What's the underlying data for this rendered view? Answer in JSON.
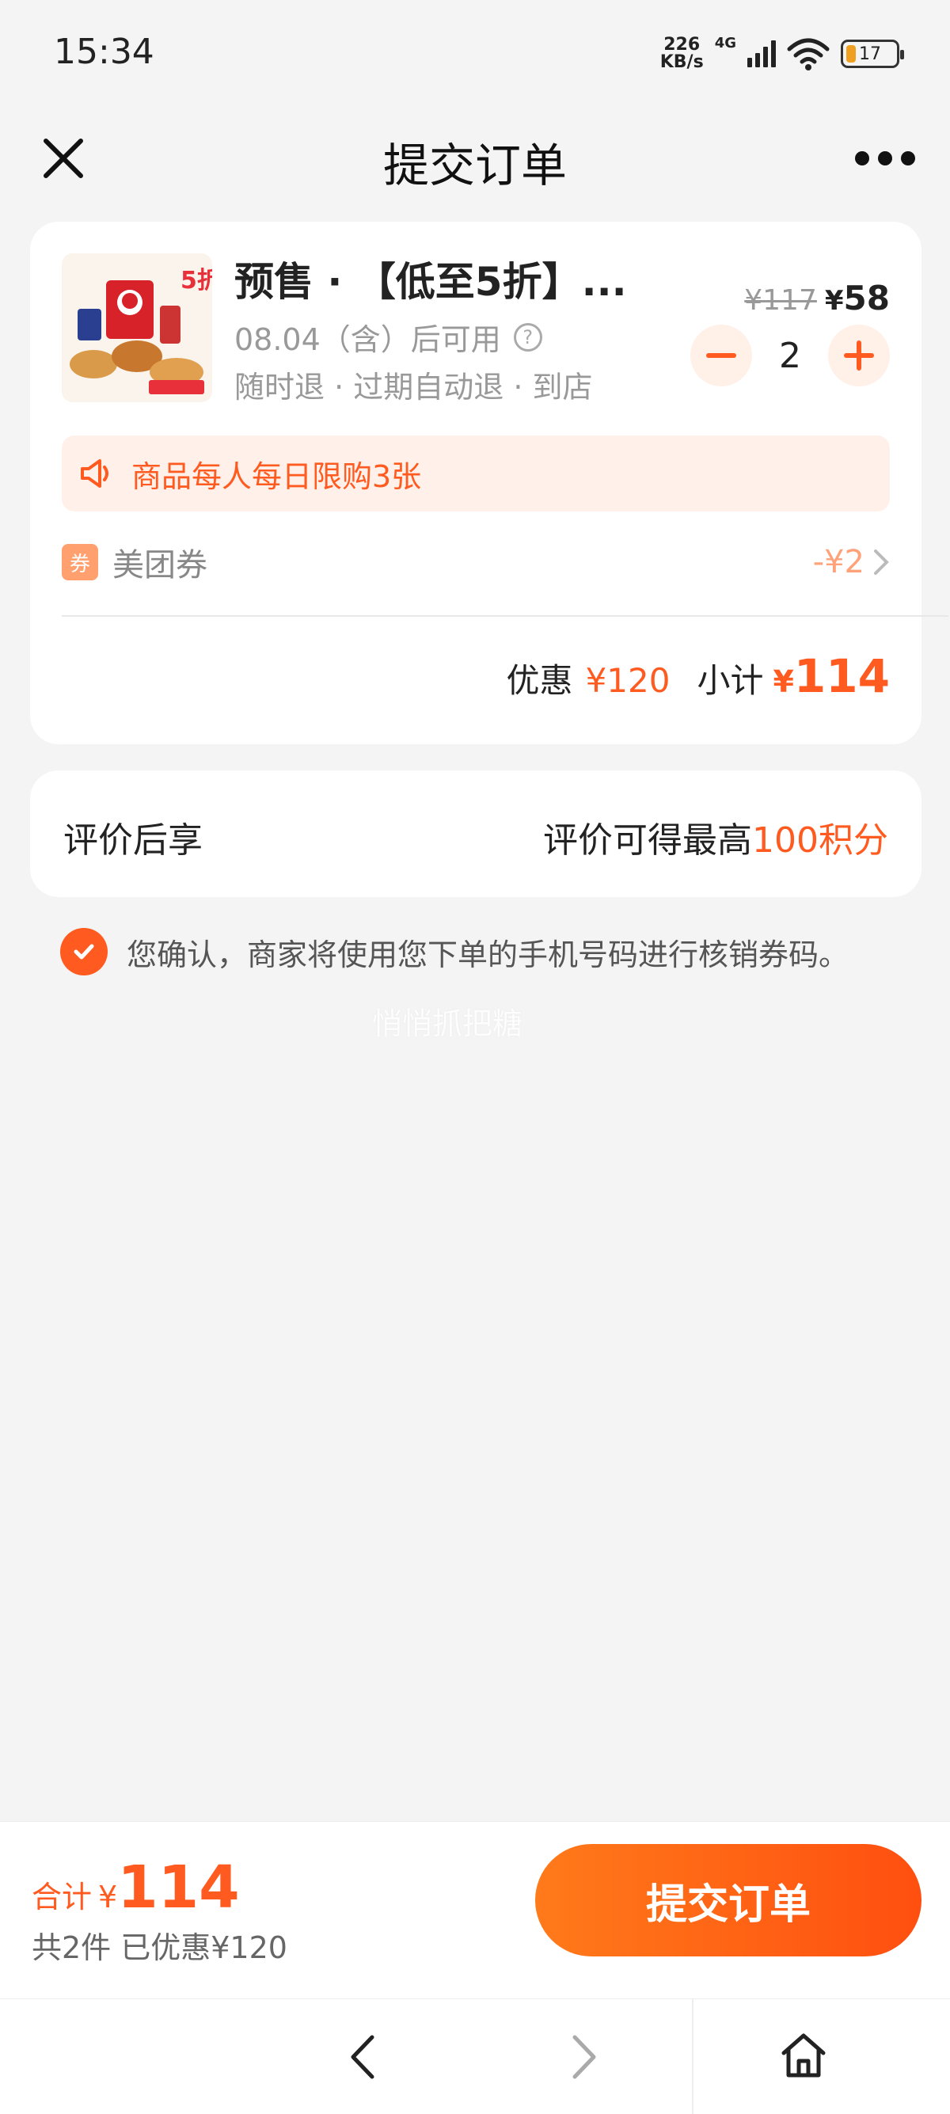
{
  "status_bar": {
    "time": "15:34",
    "net_speed_value": "226",
    "net_speed_unit": "KB/s",
    "network_type": "4G",
    "battery_level": "17"
  },
  "nav": {
    "title": "提交订单",
    "close_icon": "close-icon",
    "more_icon": "more-icon"
  },
  "product": {
    "title": "预售 · 【低至5折】...",
    "image_badge": "5折",
    "date": "08.04（含）后可用",
    "tags": "随时退 · 过期自动退 · 到店",
    "price_old": "¥117",
    "price_currency": "¥",
    "price_new": "58",
    "quantity": "2"
  },
  "limit_notice": "商品每人每日限购3张",
  "coupon": {
    "badge": "券",
    "label": "美团券",
    "value": "-¥2"
  },
  "subtotal": {
    "discount_label": "优惠",
    "discount_value": "¥120",
    "total_label": "小计",
    "total_currency": "¥",
    "total_value": "114"
  },
  "review": {
    "left": "评价后享",
    "right_prefix": "评价可得最高",
    "right_highlight": "100积分"
  },
  "confirm_text": "您确认，商家将使用您下单的手机号码进行核销券码。",
  "watermark": "悄悄抓把糖",
  "bottom": {
    "total_label": "合计",
    "total_currency": "¥",
    "total_value": "114",
    "summary": "共2件  已优惠¥120",
    "submit_label": "提交订单"
  },
  "colors": {
    "accent": "#ff5a1f",
    "accent_light": "#fff1ea",
    "background": "#f4f4f4"
  }
}
